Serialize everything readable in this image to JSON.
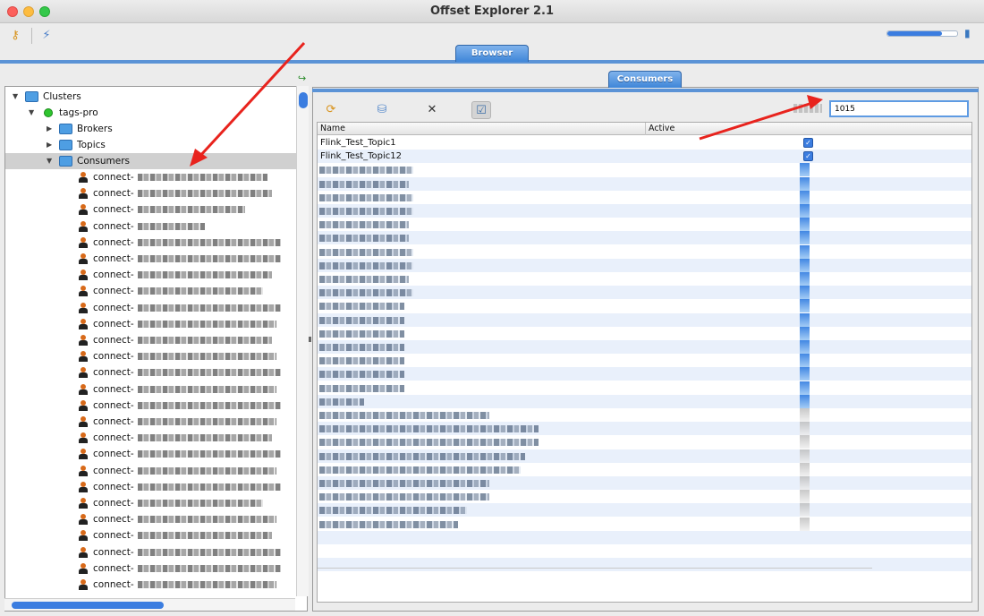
{
  "window": {
    "title": "Offset Explorer  2.1"
  },
  "toolbar": {
    "memory_level": 0.78
  },
  "tabs": {
    "browser": "Browser",
    "consumers": "Consumers"
  },
  "tree": {
    "root": "Clusters",
    "cluster": "tags-pro",
    "brokers": "Brokers",
    "topics": "Topics",
    "consumers": "Consumers",
    "consumer_prefixes": [
      "connect-",
      "connect-",
      "connect-",
      "connect-",
      "connect-",
      "connect-",
      "connect-",
      "connect-",
      "connect-",
      "connect-",
      "connect-",
      "connect-",
      "connect-",
      "connect-",
      "connect-",
      "connect-",
      "connect-",
      "connect-",
      "connect-",
      "connect-",
      "connect-",
      "connect-",
      "connect-",
      "connect-",
      "connect-",
      "connect-"
    ]
  },
  "consumers_panel": {
    "filter_value": "1015",
    "columns": {
      "name": "Name",
      "active": "Active"
    },
    "rows": [
      {
        "name": "Flink_Test_Topic1",
        "active": true
      },
      {
        "name": "Flink_Test_Topic12",
        "active": true
      }
    ]
  }
}
